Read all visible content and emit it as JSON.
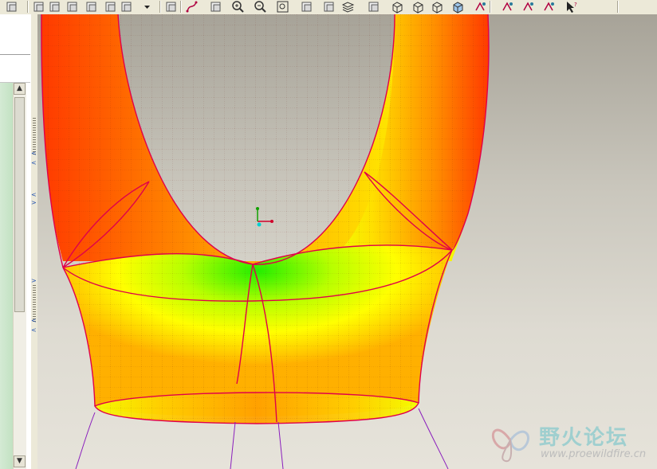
{
  "toolbar": {
    "icons": [
      "redo-icon",
      "copy-icon",
      "paste-icon",
      "paste-special-icon",
      "model-tree-icon",
      "find-icon",
      "selection-filter-icon",
      "dropdown-icon",
      "sketch-icon",
      "datum-curve-icon",
      "spin-center-icon",
      "zoom-in-icon",
      "zoom-out-icon",
      "refit-icon",
      "named-view-icon",
      "orient-icon",
      "layers-icon",
      "view-manager-icon",
      "wireframe-icon",
      "hidden-line-icon",
      "no-hidden-icon",
      "shading-icon",
      "datum-planes-icon",
      "datum-axes-icon",
      "datum-points-icon",
      "coordinate-systems-icon",
      "context-help-icon"
    ]
  },
  "left_panel": {
    "scroll_up": "▲",
    "scroll_down": "▼",
    "collapse_arrows": [
      "<",
      "<",
      "<",
      ">",
      ">",
      "<",
      "<"
    ]
  },
  "viewport": {
    "model_colors": {
      "hot": "#ff4a00",
      "warm": "#ffb300",
      "mid": "#ffff00",
      "cool": "#22ee00",
      "edge": "#e0004a",
      "curve": "#8a1dbd"
    },
    "background_top": "#a7a398",
    "background_bottom": "#e6e3da"
  },
  "watermark": {
    "title": "野火论坛",
    "url": "www.proewildfire.cn"
  }
}
